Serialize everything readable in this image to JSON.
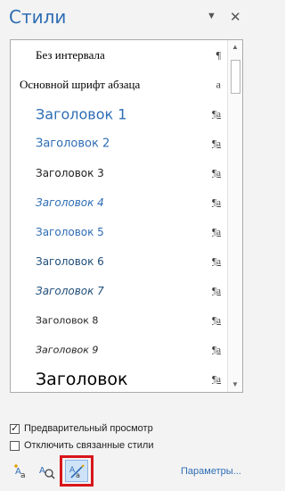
{
  "pane": {
    "title": "Стили",
    "menu_icon": "dropdown-arrow-icon",
    "close_icon": "close-icon"
  },
  "styles": [
    {
      "label": "Без интервала",
      "mark": "¶",
      "mark_type": "paragraph",
      "font": "serif",
      "size": 13,
      "color": "#000000",
      "italic": false
    },
    {
      "label": "Основной шрифт абзаца",
      "mark": "a",
      "mark_type": "character",
      "font": "serif",
      "size": 13,
      "color": "#000000",
      "italic": false
    },
    {
      "label": "Заголовок 1",
      "mark": "¶a",
      "mark_type": "linked",
      "font": "sans",
      "size": 16,
      "color": "#2e6db4",
      "italic": false
    },
    {
      "label": "Заголовок 2",
      "mark": "¶a",
      "mark_type": "linked",
      "font": "sans",
      "size": 13,
      "color": "#2e6db4",
      "italic": false
    },
    {
      "label": "Заголовок 3",
      "mark": "¶a",
      "mark_type": "linked",
      "font": "sans",
      "size": 12,
      "color": "#222222",
      "italic": false
    },
    {
      "label": "Заголовок 4",
      "mark": "¶a",
      "mark_type": "linked",
      "font": "sans",
      "size": 12,
      "color": "#2e6db4",
      "italic": true
    },
    {
      "label": "Заголовок 5",
      "mark": "¶a",
      "mark_type": "linked",
      "font": "sans",
      "size": 12,
      "color": "#2e6db4",
      "italic": false
    },
    {
      "label": "Заголовок 6",
      "mark": "¶a",
      "mark_type": "linked",
      "font": "sans",
      "size": 12,
      "color": "#1f4d78",
      "italic": false
    },
    {
      "label": "Заголовок 7",
      "mark": "¶a",
      "mark_type": "linked",
      "font": "sans",
      "size": 12,
      "color": "#1f4d78",
      "italic": true
    },
    {
      "label": "Заголовок 8",
      "mark": "¶a",
      "mark_type": "linked",
      "font": "sans",
      "size": 11,
      "color": "#222222",
      "italic": false
    },
    {
      "label": "Заголовок 9",
      "mark": "¶a",
      "mark_type": "linked",
      "font": "sans",
      "size": 11,
      "color": "#222222",
      "italic": true
    },
    {
      "label": "Заголовок",
      "mark": "¶a",
      "mark_type": "linked",
      "font": "sans",
      "size": 19,
      "color": "#000000",
      "italic": false
    }
  ],
  "options": {
    "preview": {
      "label": "Предварительный просмотр",
      "checked": true
    },
    "disable_linked": {
      "label": "Отключить связанные стили",
      "checked": false
    }
  },
  "toolbar": {
    "new_style_icon": "new-style-icon",
    "style_inspector_icon": "style-inspector-icon",
    "manage_styles_icon": "manage-styles-icon",
    "options_link": "Параметры..."
  },
  "scrollbar": {
    "up_icon": "scroll-up-icon",
    "down_icon": "scroll-down-icon"
  }
}
